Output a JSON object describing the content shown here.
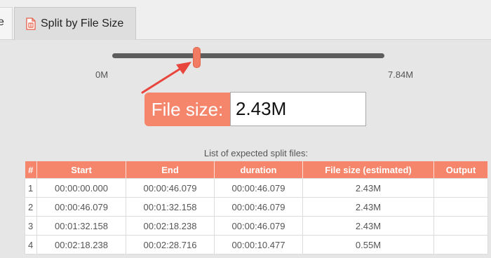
{
  "tabs": {
    "partial_label": "e",
    "active_label": "Split by File Size"
  },
  "slider": {
    "min_label": "0M",
    "max_label": "7.84M",
    "value_fraction": 0.31
  },
  "file_size": {
    "label": "File size:",
    "value": "2.43M"
  },
  "split_list": {
    "caption": "List of expected split files:",
    "headers": [
      "#",
      "Start",
      "End",
      "duration",
      "File size (estimated)",
      "Output"
    ],
    "rows": [
      [
        "1",
        "00:00:00.000",
        "00:00:46.079",
        "00:00:46.079",
        "2.43M",
        ""
      ],
      [
        "2",
        "00:00:46.079",
        "00:01:32.158",
        "00:00:46.079",
        "2.43M",
        ""
      ],
      [
        "3",
        "00:01:32.158",
        "00:02:18.238",
        "00:00:46.079",
        "2.43M",
        ""
      ],
      [
        "4",
        "00:02:18.238",
        "00:02:28.716",
        "00:00:10.477",
        "0.55M",
        ""
      ]
    ]
  },
  "colors": {
    "accent": "#f5866b",
    "slider_track": "#5d5d5d",
    "arrow": "#e8453c"
  },
  "icons": {
    "tab_icon": "file-split-icon"
  }
}
